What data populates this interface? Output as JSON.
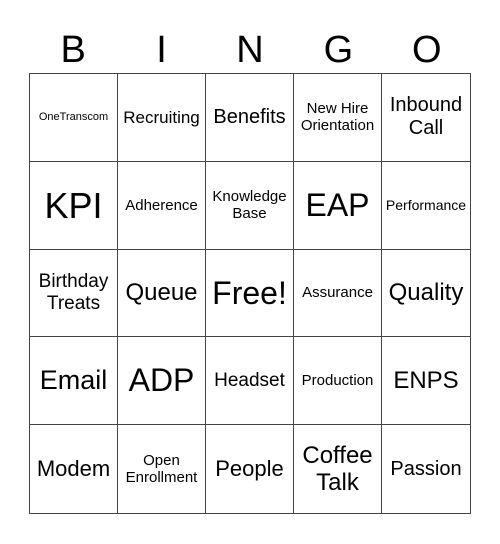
{
  "header": {
    "letters": [
      "B",
      "I",
      "N",
      "G",
      "O"
    ]
  },
  "cells": [
    "OneTranscom",
    "Recruiting",
    "Benefits",
    "New Hire Orientation",
    "Inbound Call",
    "KPI",
    "Adherence",
    "Knowledge Base",
    "EAP",
    "Performance",
    "Birthday Treats",
    "Queue",
    "Free!",
    "Assurance",
    "Quality",
    "Email",
    "ADP",
    "Headset",
    "Production",
    "ENPS",
    "Modem",
    "Open Enrollment",
    "People",
    "Coffee Talk",
    "Passion"
  ]
}
